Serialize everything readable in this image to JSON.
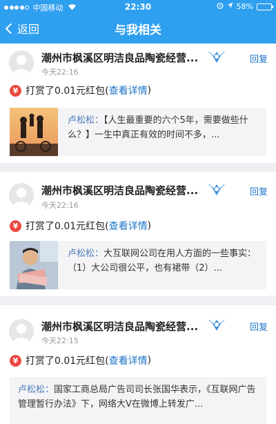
{
  "status_bar": {
    "carrier": "中国移动",
    "time": "22:30",
    "battery": "58%",
    "battery_level": 0.58
  },
  "nav": {
    "back_label": "返回",
    "title": "与我相关"
  },
  "colors": {
    "nav_bg": "#2f9fef",
    "link": "#1a73c8",
    "author": "#4a79b8",
    "coin": "#e9483f"
  },
  "items": [
    {
      "name": "潮州市枫溪区明洁良品陶瓷经营...",
      "time": "今天22:16",
      "reply_label": "回复",
      "reward_text": "打赏了0.01元红包(",
      "reward_link": "查看详情",
      "reward_close": ")",
      "coin_glyph": "¥",
      "quote_author": "卢松松：",
      "quote_text": "【人生最重要的六个5年，需要做些什么？】一生中真正有效的时间不多，...",
      "thumb_icon": "family-silhouette-photo"
    },
    {
      "name": "潮州市枫溪区明洁良品陶瓷经营...",
      "time": "今天22:16",
      "reply_label": "回复",
      "reward_text": "打赏了0.01元红包(",
      "reward_link": "查看详情",
      "reward_close": ")",
      "coin_glyph": "¥",
      "quote_author": "卢松松：",
      "quote_text": "大互联网公司在用人方面的一些事实：（1）大公司很公平，也有裙带（2）...",
      "thumb_icon": "man-with-money-photo"
    },
    {
      "name": "潮州市枫溪区明洁良品陶瓷经营...",
      "time": "今天22:15",
      "reply_label": "回复",
      "reward_text": "打赏了0.01元红包(",
      "reward_link": "查看详情",
      "reward_close": ")",
      "coin_glyph": "¥",
      "quote_author": "卢松松：",
      "quote_text": "国家工商总局广告司司长张国华表示，《互联网广告管理暂行办法》下，网络大V在微博上转发广..."
    }
  ]
}
